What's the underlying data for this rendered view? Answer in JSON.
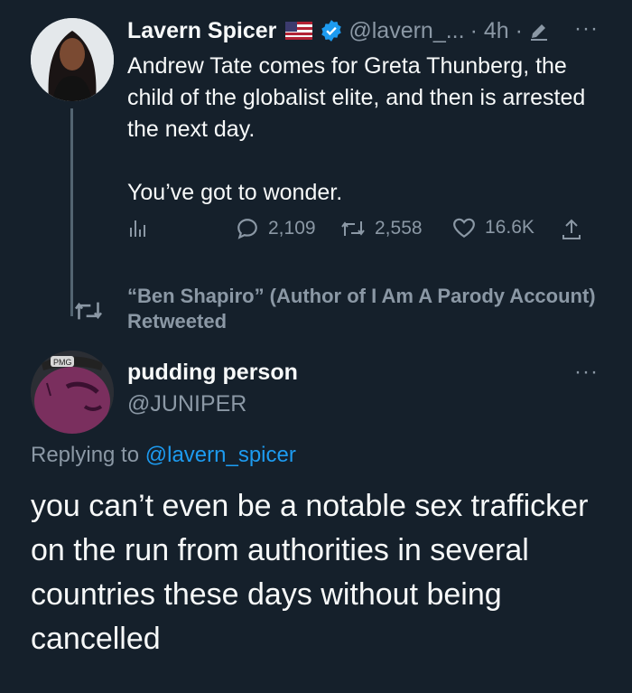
{
  "tweet": {
    "author_name": "Lavern Spicer",
    "handle": "@lavern_...",
    "time": "· 4h ·",
    "more": "···",
    "paragraphs": [
      "Andrew Tate comes for Greta Thunberg, the child of the globalist elite, and then is arrested the next day.",
      "You’ve got to wonder."
    ],
    "replies": "2,109",
    "retweets": "2,558",
    "likes": "16.6K"
  },
  "retweet_banner": "“Ben Shapiro” (Author of I Am A Parody Account) Retweeted",
  "reply": {
    "author_name": "pudding person",
    "handle": "@JUNIPER",
    "more": "···",
    "replying_prefix": "Replying to ",
    "replying_handle": "@lavern_spicer",
    "text": "you can’t even be a notable sex trafficker on the run from authorities in several countries these days without being cancelled",
    "avatar_cap_text": "PMG"
  },
  "colors": {
    "background": "#15202b",
    "text": "#f7f9f9",
    "secondary": "#8b98a5",
    "link": "#1d9bf0"
  }
}
